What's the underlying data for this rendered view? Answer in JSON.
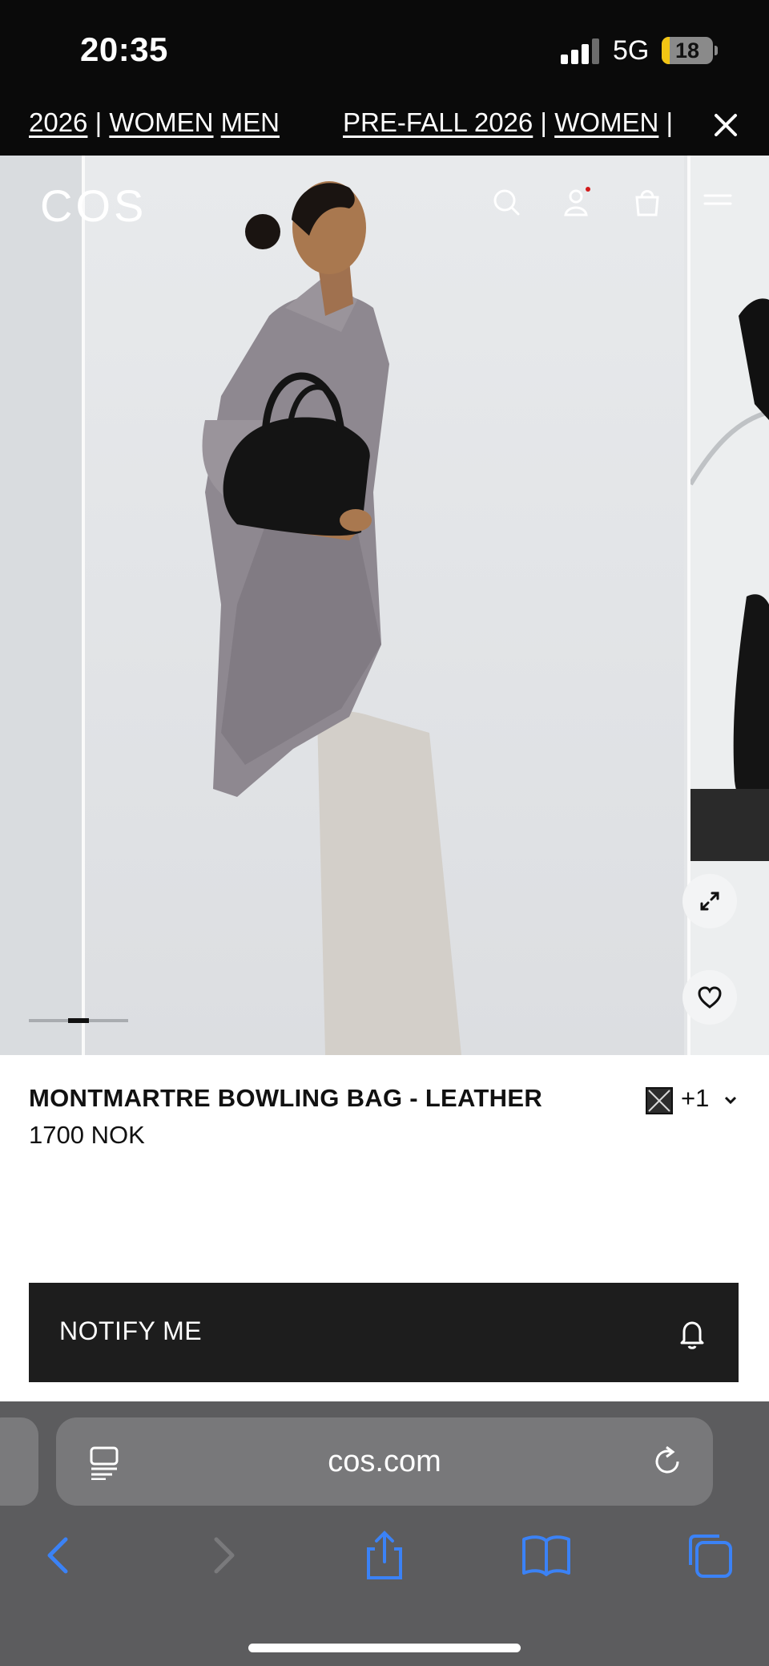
{
  "status_bar": {
    "time": "20:35",
    "network": "5G",
    "battery_level": "18"
  },
  "promo_banner": {
    "segments": [
      {
        "pre": "2026",
        "sep": " | ",
        "women": "WOMEN",
        "men": "MEN"
      },
      {
        "pre": "PRE-FALL 2026",
        "sep": " | ",
        "women": "WOMEN",
        "men": "|"
      }
    ]
  },
  "header": {
    "logo": "COS",
    "icons": [
      "search-icon",
      "account-icon",
      "bag-icon",
      "menu-icon"
    ]
  },
  "gallery": {
    "image_description_icon": "product-photo",
    "active_index_fraction": 0.5
  },
  "product": {
    "name": "MONTMARTRE BOWLING BAG - LEATHER",
    "price": "1700 NOK",
    "color_more": "+1"
  },
  "notify": {
    "label": "NOTIFY ME"
  },
  "browser": {
    "url": "cos.com"
  },
  "colors": {
    "status_bg": "#0a0a0a",
    "notify_bg": "#1d1d1d",
    "browser_bg": "#5c5c5e",
    "accent_blue": "#3b82f6",
    "battery_yellow": "#f2c514",
    "notification_dot": "#d21a1a"
  }
}
